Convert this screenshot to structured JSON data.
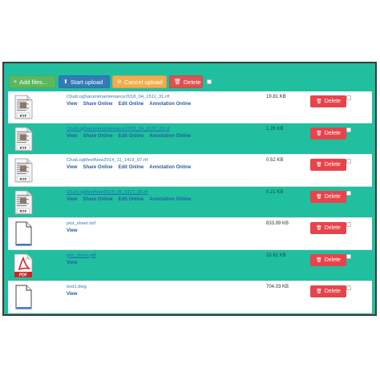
{
  "toolbar": {
    "add_label": "Add files...",
    "start_label": "Start upload",
    "cancel_label": "Cancel upload",
    "delete_label": "Delete",
    "add_icon": "+",
    "start_icon": "⬆",
    "cancel_icon": "⊘",
    "delete_icon": "🗑"
  },
  "row_delete_label": "Delete",
  "colors": {
    "panel": "#1fbfa0",
    "add": "#5cb85c",
    "start": "#337ab7",
    "cancel": "#f0ad4e",
    "delete": "#e8434b"
  },
  "files": [
    {
      "name": "ChatLogSarumimaintenance2018_04_1511_31.rtf",
      "size": "19.81 KB",
      "icon": "rtf-file-icon",
      "links": [
        "View",
        "Share Online",
        "Edit Online",
        "Annotation Online"
      ]
    },
    {
      "name": "ChatLogSarumimaintenance2018_04_0137_29.rtf",
      "size": "1.26 KB",
      "icon": "rtf-file-icon",
      "links": [
        "View",
        "Share Online",
        "Edit Online",
        "Annotation Online"
      ]
    },
    {
      "name": "ChatLogMeetNow2014_11_1419_07.rtf",
      "size": "0.52 KB",
      "icon": "rtf-file-icon",
      "links": [
        "View",
        "Share Online",
        "Edit Online",
        "Annotation Online"
      ]
    },
    {
      "name": "ChatLogMeetNow2014_05_0317_05.rtf",
      "size": "0.21 KB",
      "icon": "rtf-file-icon",
      "links": [
        "View",
        "Share Online",
        "Edit Online",
        "Annotation Online"
      ]
    },
    {
      "name": "plot_sheet.dxf",
      "size": "833.99 KB",
      "icon": "generic-file-icon",
      "links": [
        "View"
      ]
    },
    {
      "name": "plot_sheet.pdf",
      "size": "33.61 KB",
      "icon": "pdf-file-icon",
      "links": [
        "View"
      ]
    },
    {
      "name": "test1.dwg",
      "size": "704.03 KB",
      "icon": "generic-file-icon",
      "links": [
        "View"
      ]
    }
  ]
}
